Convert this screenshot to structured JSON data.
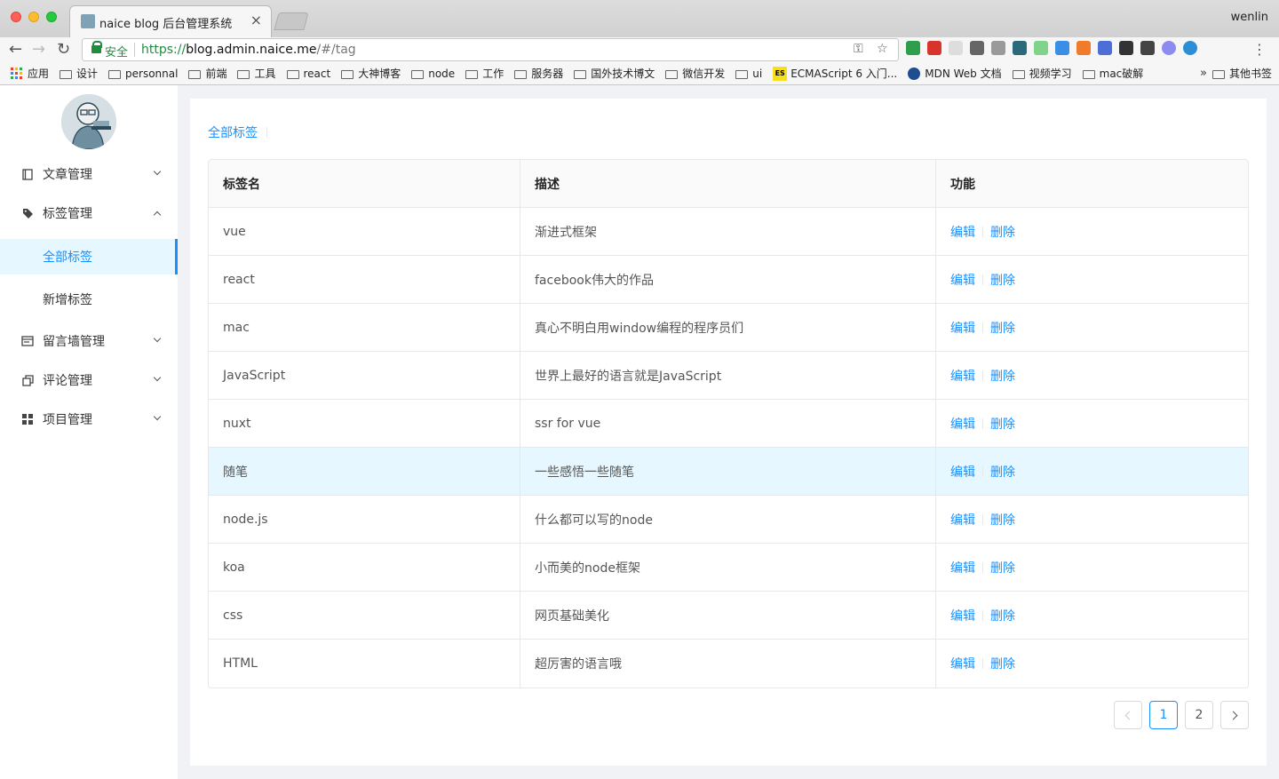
{
  "browser": {
    "tab_title": "naice blog 后台管理系统",
    "user": "wenlin",
    "secure_label": "安全",
    "url_scheme": "https://",
    "url_host": "blog.admin.naice.me",
    "url_path": "/#/tag"
  },
  "bookmarks": {
    "apps": "应用",
    "items": [
      "设计",
      "personnal",
      "前端",
      "工具",
      "react",
      "大神博客",
      "node",
      "工作",
      "服务器",
      "国外技术博文",
      "微信开发",
      "ui"
    ],
    "es_badge": "ES",
    "es_label": "ECMAScript 6 入门...",
    "mdn_label": "MDN Web 文档",
    "items2": [
      "视频学习",
      "mac破解"
    ],
    "more": "»",
    "other": "其他书签"
  },
  "sidebar": {
    "menu": {
      "articles": "文章管理",
      "tags": "标签管理",
      "guestbook": "留言墙管理",
      "comments": "评论管理",
      "projects": "项目管理"
    },
    "sub": {
      "all_tags": "全部标签",
      "new_tag": "新增标签"
    }
  },
  "main": {
    "breadcrumb": "全部标签",
    "columns": [
      "标签名",
      "描述",
      "功能"
    ],
    "rows": [
      {
        "name": "vue",
        "desc": "渐进式框架"
      },
      {
        "name": "react",
        "desc": "facebook伟大的作品"
      },
      {
        "name": "mac",
        "desc": "真心不明白用window编程的程序员们"
      },
      {
        "name": "JavaScript",
        "desc": "世界上最好的语言就是JavaScript"
      },
      {
        "name": "nuxt",
        "desc": "ssr for vue"
      },
      {
        "name": "随笔",
        "desc": "一些感悟一些随笔"
      },
      {
        "name": "node.js",
        "desc": "什么都可以写的node"
      },
      {
        "name": "koa",
        "desc": "小而美的node框架"
      },
      {
        "name": "css",
        "desc": "网页基础美化"
      },
      {
        "name": "HTML",
        "desc": "超厉害的语言哦"
      }
    ],
    "edit_label": "编辑",
    "delete_label": "删除",
    "pages": [
      "1",
      "2"
    ]
  },
  "colors": {
    "accent": "#1890ff",
    "highlight_row": "#e6f7ff"
  }
}
